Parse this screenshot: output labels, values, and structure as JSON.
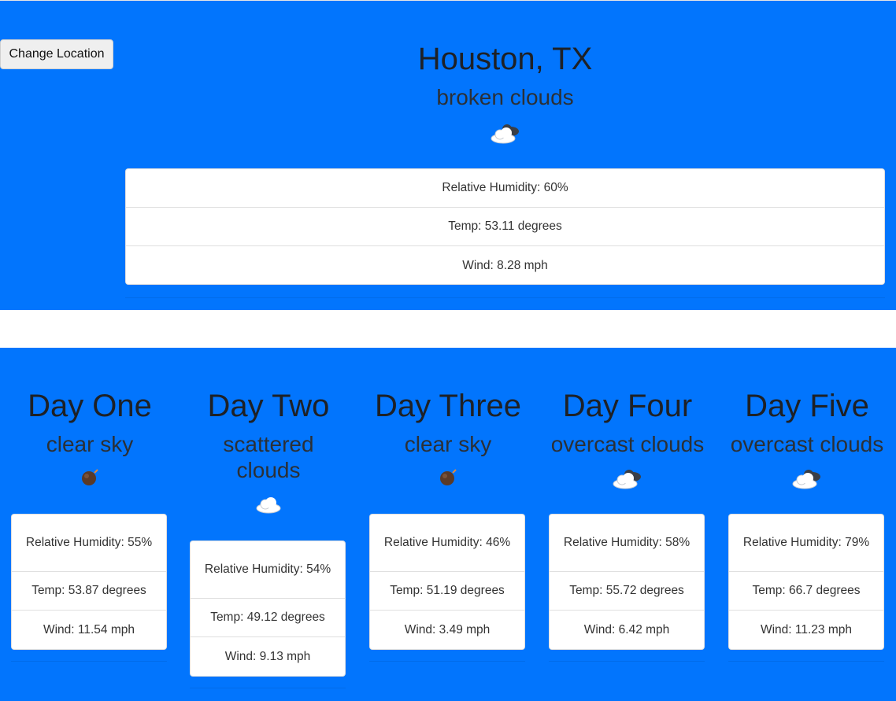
{
  "change_location_label": "Change Location",
  "current": {
    "city": "Houston, TX",
    "description": "broken clouds",
    "icon": "broken-clouds-icon",
    "humidity": "Relative Humidity: 60%",
    "temp": "Temp: 53.11 degrees",
    "wind": "Wind: 8.28 mph"
  },
  "forecast": [
    {
      "title": "Day One",
      "description": "clear sky",
      "icon": "clear-sky-icon",
      "humidity": "Relative Humidity: 55%",
      "temp": "Temp: 53.87 degrees",
      "wind": "Wind: 11.54 mph"
    },
    {
      "title": "Day Two",
      "description": "scattered clouds",
      "icon": "scattered-clouds-icon",
      "humidity": "Relative Humidity: 54%",
      "temp": "Temp: 49.12 degrees",
      "wind": "Wind: 9.13 mph"
    },
    {
      "title": "Day Three",
      "description": "clear sky",
      "icon": "clear-sky-icon",
      "humidity": "Relative Humidity: 46%",
      "temp": "Temp: 51.19 degrees",
      "wind": "Wind: 3.49 mph"
    },
    {
      "title": "Day Four",
      "description": "overcast clouds",
      "icon": "overcast-clouds-icon",
      "humidity": "Relative Humidity: 58%",
      "temp": "Temp: 55.72 degrees",
      "wind": "Wind: 6.42 mph"
    },
    {
      "title": "Day Five",
      "description": "overcast clouds",
      "icon": "overcast-clouds-icon",
      "humidity": "Relative Humidity: 79%",
      "temp": "Temp: 66.7 degrees",
      "wind": "Wind: 11.23 mph"
    }
  ],
  "colors": {
    "panel_blue": "#0275fd",
    "text_dark": "#1e2126"
  }
}
